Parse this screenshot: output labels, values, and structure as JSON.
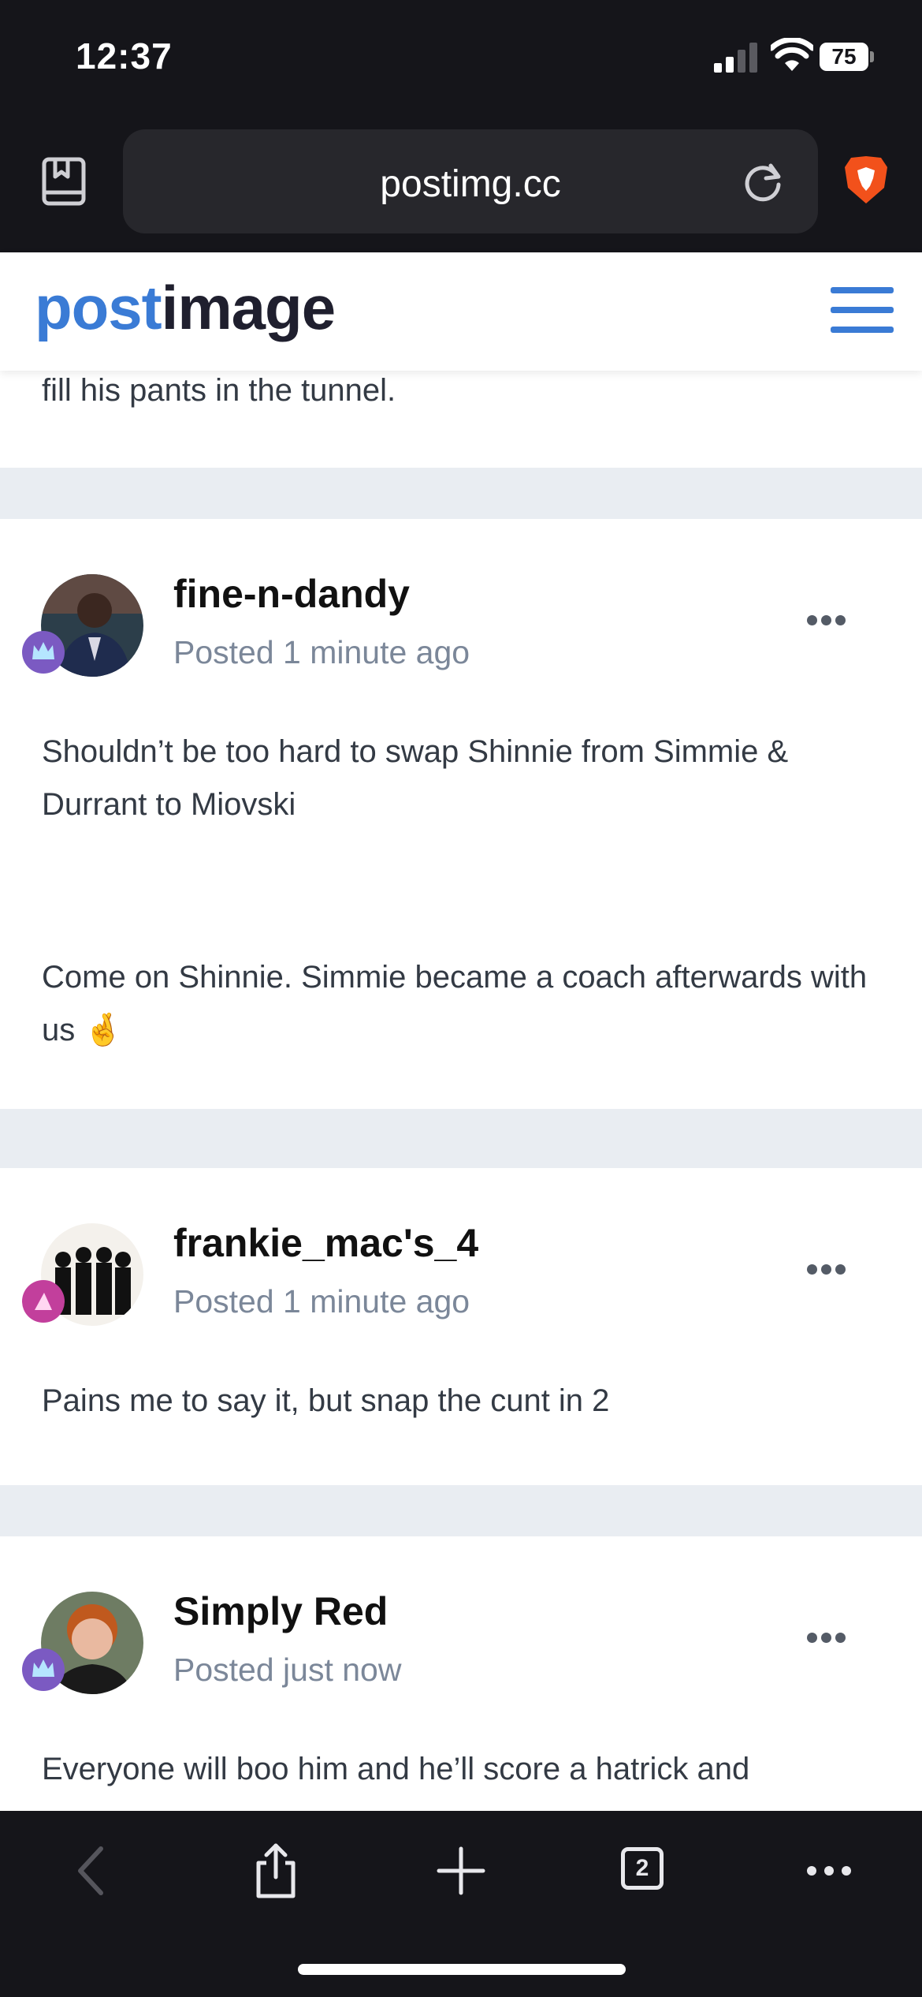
{
  "status_bar": {
    "time": "12:37",
    "battery": "75"
  },
  "browser": {
    "url": "postimg.cc",
    "tab_count": "2"
  },
  "site": {
    "logo_part1": "post",
    "logo_part2": "image"
  },
  "posts": [
    {
      "text_fragment": "fill his pants in the tunnel."
    },
    {
      "author": "fine-n-dandy",
      "posted": "Posted 1 minute ago",
      "paragraphs": [
        "Shouldn’t be too hard to swap Shinnie from Simmie & Durrant to Miovski",
        "Come on Shinnie. Simmie became a coach afterwards with us"
      ],
      "emoji": "🤞"
    },
    {
      "author": "frankie_mac's_4",
      "posted": "Posted 1 minute ago",
      "paragraphs": [
        "Pains me to say it, but snap the cunt in 2"
      ]
    },
    {
      "author": "Simply Red",
      "posted": "Posted just now",
      "paragraphs": [
        "Everyone will boo him and he’ll score a hatrick and"
      ]
    }
  ],
  "colors": {
    "brand_blue": "#3a7bd5",
    "badge_purple": "#7b5ac2",
    "badge_pink": "#c23f9c",
    "meta_gray": "#7b8799"
  }
}
